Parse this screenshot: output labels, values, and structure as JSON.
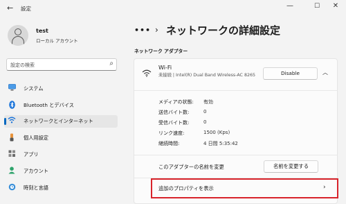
{
  "window": {
    "title": "設定",
    "controls": {
      "minimize": "—",
      "maximize": "☐",
      "close": "✕"
    }
  },
  "user": {
    "name": "test",
    "account_type": "ローカル アカウント"
  },
  "search": {
    "placeholder": "設定の検索"
  },
  "sidebar": {
    "items": [
      {
        "label": "システム",
        "icon": "monitor-icon"
      },
      {
        "label": "Bluetooth とデバイス",
        "icon": "bluetooth-icon"
      },
      {
        "label": "ネットワークとインターネット",
        "icon": "network-icon",
        "selected": true
      },
      {
        "label": "個人用設定",
        "icon": "brush-icon"
      },
      {
        "label": "アプリ",
        "icon": "apps-icon"
      },
      {
        "label": "アカウント",
        "icon": "account-icon"
      },
      {
        "label": "時刻と言語",
        "icon": "clock-globe-icon"
      }
    ]
  },
  "header": {
    "breadcrumb_more": "•••",
    "title": "ネットワークの詳細設定"
  },
  "section": {
    "title": "ネットワーク アダプター"
  },
  "adapter": {
    "name": "Wi-Fi",
    "description": "未接続 | Intel(R) Dual Band Wireless-AC 8265",
    "disable_label": "Disable",
    "properties": [
      {
        "label": "メディアの状態:",
        "value": "有効"
      },
      {
        "label": "送信バイト数:",
        "value": "0"
      },
      {
        "label": "受信バイト数:",
        "value": "0"
      },
      {
        "label": "リンク速度:",
        "value": "1500 (Kps)"
      },
      {
        "label": "継続時間:",
        "value": "4 日間 5:35:42"
      }
    ],
    "rename_label": "このアダプターの名前を変更",
    "rename_button": "名前を変更する",
    "more_properties_label": "追加のプロパティを表示"
  },
  "colors": {
    "accent": "#0067c0",
    "highlight": "#d8232a"
  }
}
